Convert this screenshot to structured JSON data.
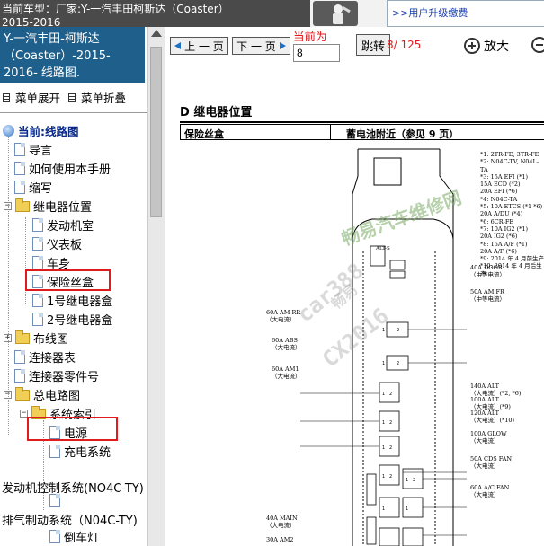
{
  "header": {
    "car_title_line1": "当前车型：厂家:Y-一汽丰田柯斯达（Coaster）",
    "car_title_line2": "2015-2016"
  },
  "ad": {
    "text": ">>用户升级缴费"
  },
  "nav": {
    "title_line1": "Y-一汽丰田-柯斯达",
    "title_line2": "（Coaster）-2015-",
    "title_line3": "2016- 线路图.",
    "expand_label": "菜单展开",
    "collapse_label": "菜单折叠"
  },
  "tree": {
    "current_label": "当前:线路图",
    "items": [
      {
        "label": "导言"
      },
      {
        "label": "如何使用本手册"
      },
      {
        "label": "缩写"
      },
      {
        "label": "继电器位置"
      },
      {
        "label": "发动机室"
      },
      {
        "label": "仪表板"
      },
      {
        "label": "车身"
      },
      {
        "label": "保险丝盒"
      },
      {
        "label": "1号继电器盒"
      },
      {
        "label": "2号继电器盒"
      },
      {
        "label": "布线图"
      },
      {
        "label": "连接器表"
      },
      {
        "label": "连接器零件号"
      },
      {
        "label": "总电路图"
      },
      {
        "label": "系统索引"
      },
      {
        "label": "电源"
      },
      {
        "label": "充电系统"
      },
      {
        "label": "发动机控制系统(NO4C-TY)"
      },
      {
        "label": "排气制动系统（N04C-TY)"
      },
      {
        "label": "倒车灯"
      }
    ]
  },
  "toolbar": {
    "prev_label": "上 一 页",
    "next_label": "下 一 页",
    "current_label": "当前为",
    "page_value": "8",
    "jump_label": "跳转",
    "page_total": "8/ 125",
    "zoom_in_label": "放大"
  },
  "document": {
    "section_title": "D  继电器位置",
    "col1": "保险丝盒",
    "col2": "蓄电池附近（参见 9 页）",
    "notes": [
      "*1: 2TR-FE, 3TR-FE",
      "*2: N04C-TV, N04L-TA",
      "*3: 15A EFI (*1)",
      "    15A ECD (*2)",
      "    20A EFI (*6)",
      "*4: N04C-TA",
      "*5: 10A ETCS (*1 *6)",
      "    20A A/DU (*4)",
      "*6: 6CR-FE",
      "*7: 10A IG2 (*1)",
      "    20A IG2 (*6)",
      "*8: 15A A/F (*1)",
      "    20A A/F (*6)",
      "*9: 2014 年 4 月前生产",
      "*10: 2014 年 4 月后生产"
    ],
    "fuses_right": [
      {
        "name": "40A DOOR",
        "sub": "（中等电流）"
      },
      {
        "name": "50A AM FR",
        "sub": "（中等电流）"
      },
      {
        "name": "140A ALT",
        "sub": "（大电流）(*2, *6)"
      },
      {
        "name": "100A ALT",
        "sub": "（大电流）(*9)"
      },
      {
        "name": "120A ALT",
        "sub": "（大电流）(*10)"
      },
      {
        "name": "100A GLOW",
        "sub": "（大电流）"
      },
      {
        "name": "50A CDS FAN",
        "sub": "（大电流）"
      },
      {
        "name": "60A A/C FAN",
        "sub": "（大电流）"
      }
    ],
    "fuses_left": [
      {
        "name": "60A AM RR",
        "sub": "（大电流）"
      },
      {
        "name": "60A ABS",
        "sub": "（大电流）"
      },
      {
        "name": "60A AM1",
        "sub": "（大电流）"
      },
      {
        "name": "40A MAIN",
        "sub": "（大电流）"
      },
      {
        "name": "30A AM2",
        "sub": ""
      }
    ],
    "small_label": "ALT-S",
    "watermark_site": "畅易汽车维修网",
    "watermark_code1": "car388",
    "watermark_code2": "CX2016",
    "watermark_brand": "畅易"
  }
}
